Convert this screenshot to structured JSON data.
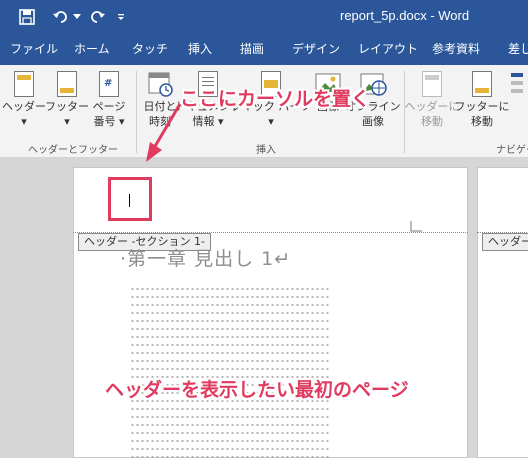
{
  "window": {
    "title": "report_5p.docx - Word"
  },
  "quick_access": {
    "save_icon": "save-icon",
    "undo_icon": "undo-icon",
    "redo_icon": "redo-icon",
    "customize_icon": "customize-qat-icon"
  },
  "tabs": [
    "ファイル",
    "ホーム",
    "タッチ",
    "挿入",
    "描画",
    "デザイン",
    "レイアウト",
    "参考資料",
    "差し"
  ],
  "ribbon": {
    "header": {
      "label": "ヘッダー",
      "caret": "▾"
    },
    "footer": {
      "label": "フッター",
      "caret": "▾"
    },
    "page_number": {
      "label1": "ページ",
      "label2": "番号 ▾"
    },
    "group1_label": "ヘッダーとフッター",
    "datetime": {
      "label1": "日付と",
      "label2": "時刻"
    },
    "doc_info": {
      "label1": "ドキュメント",
      "label2": "情報 ▾"
    },
    "quick_parts": {
      "label1": "クイック パーツ",
      "label2": "▾"
    },
    "picture": {
      "label1": "画像"
    },
    "online_picture": {
      "label1": "オンライン",
      "label2": "画像"
    },
    "group2_label": "挿入",
    "goto_header": {
      "label1": "ヘッダーに",
      "label2": "移動"
    },
    "goto_footer": {
      "label1": "フッターに",
      "label2": "移動"
    },
    "group3_label": "ナビゲー"
  },
  "document": {
    "header_tag": "ヘッダー -セクション 1-",
    "header_tag_right": "ヘッダー",
    "heading": "·第一章 見出し 1↵"
  },
  "annotations": {
    "top": "ここにカーソルを置く",
    "bottom": "ヘッダーを表示したい最初のページ"
  },
  "colors": {
    "title_bar": "#2b579a",
    "annotation": "#e03a5e"
  }
}
